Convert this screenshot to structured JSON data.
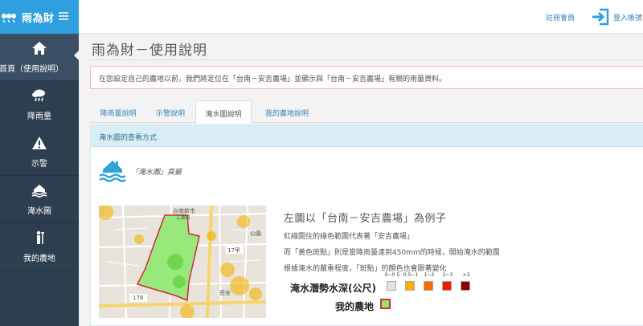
{
  "brand": {
    "name": "雨為財",
    "logo_icon": "cloud-drops-icon",
    "menu_icon": "hamburger-icon"
  },
  "nav": [
    {
      "label": "首頁（使用說明）",
      "icon": "home-icon",
      "active": true
    },
    {
      "label": "降雨量",
      "icon": "rain-cloud-icon"
    },
    {
      "label": "示警",
      "icon": "warning-icon"
    },
    {
      "label": "淹水圖",
      "icon": "flood-house-icon"
    },
    {
      "label": "我的農地",
      "icon": "farmer-icon"
    }
  ],
  "header": {
    "register": "註冊會員",
    "login": "登入帳號",
    "login_icon": "sign-in-icon"
  },
  "page": {
    "title": "雨為財－使用說明",
    "alert": "在您設定自己的農地以前，我們將定位在「台南－安吉農場」並顯示與「台南－安吉農場」有關的雨量資料。"
  },
  "tabs": [
    {
      "label": "降雨量說明"
    },
    {
      "label": "示警說明"
    },
    {
      "label": "淹水圖說明",
      "active": true
    },
    {
      "label": "我的農地說明"
    }
  ],
  "panel": {
    "heading": "淹水圖的查看方式",
    "flood_label": "「淹水圖」頁籤",
    "caption": "左圖以「台南－安吉農場」為例子",
    "line1": "紅線圍住的綠色範圍代表著「安吉農場」",
    "line2": "而「黃色斑點」則是當降雨量達到450mm的時候，開始淹水的範圍",
    "line3": "根據淹水的嚴重程度，「斑點」的顏色也會跟著變化",
    "legend_title": "淹水潛勢水深(公尺)",
    "farm_label": "我的農地",
    "legend": [
      {
        "label": "0~0.5",
        "color": "#e3e3e3"
      },
      {
        "label": "0.5~1",
        "color": "#f6b100"
      },
      {
        "label": "1~2",
        "color": "#f46b00"
      },
      {
        "label": "2~3",
        "color": "#ee1c00"
      },
      {
        "label": ">3",
        "color": "#8c0000"
      }
    ],
    "farm_swatch": {
      "fill": "#8fe870",
      "border": "#d9263c"
    },
    "map_labels": {
      "town": "台南新市",
      "district": "工業區",
      "road1": "178",
      "road2": "178",
      "road3": "17甲",
      "place1": "公園",
      "place2": "長安"
    }
  }
}
